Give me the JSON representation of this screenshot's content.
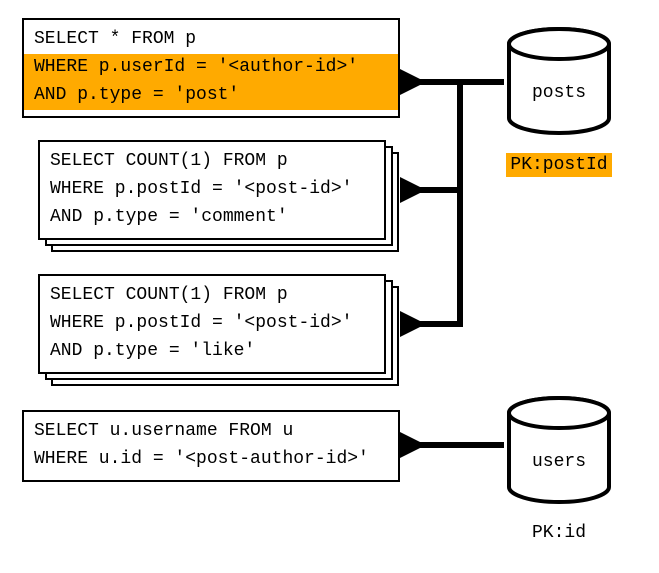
{
  "queries": {
    "q1": {
      "line1": "SELECT * FROM p",
      "line2": "WHERE p.userId = '<author-id>'",
      "line3": "AND p.type = 'post'"
    },
    "q2": {
      "line1": "SELECT COUNT(1) FROM p",
      "line2": "WHERE p.postId = '<post-id>'",
      "line3": "AND p.type = 'comment'"
    },
    "q3": {
      "line1": "SELECT COUNT(1) FROM p",
      "line2": "WHERE p.postId = '<post-id>'",
      "line3": "AND p.type = 'like'"
    },
    "q4": {
      "line1": "SELECT u.username FROM u",
      "line2": "WHERE u.id = '<post-author-id>'"
    }
  },
  "databases": {
    "posts": {
      "label": "posts",
      "pk_prefix": "PK:",
      "pk_value": "postId"
    },
    "users": {
      "label": "users",
      "pk_prefix": "PK:",
      "pk_value": "id"
    }
  },
  "colors": {
    "highlight": "#ffaa00",
    "border": "#000000",
    "background": "#ffffff"
  }
}
